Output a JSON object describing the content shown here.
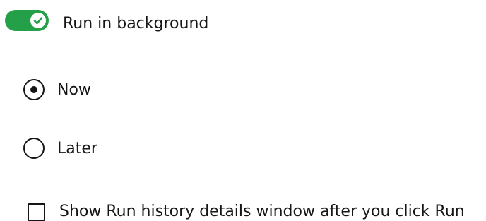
{
  "background_toggle": {
    "label": "Run in background",
    "checked": true,
    "on_color": "#24a148"
  },
  "run_timing": {
    "options": [
      {
        "label": "Now",
        "selected": true
      },
      {
        "label": "Later",
        "selected": false
      }
    ]
  },
  "history_checkbox": {
    "label": "Show Run history details window after you click Run",
    "checked": false
  },
  "icons": {
    "toggle_check": "checkmark-icon"
  }
}
